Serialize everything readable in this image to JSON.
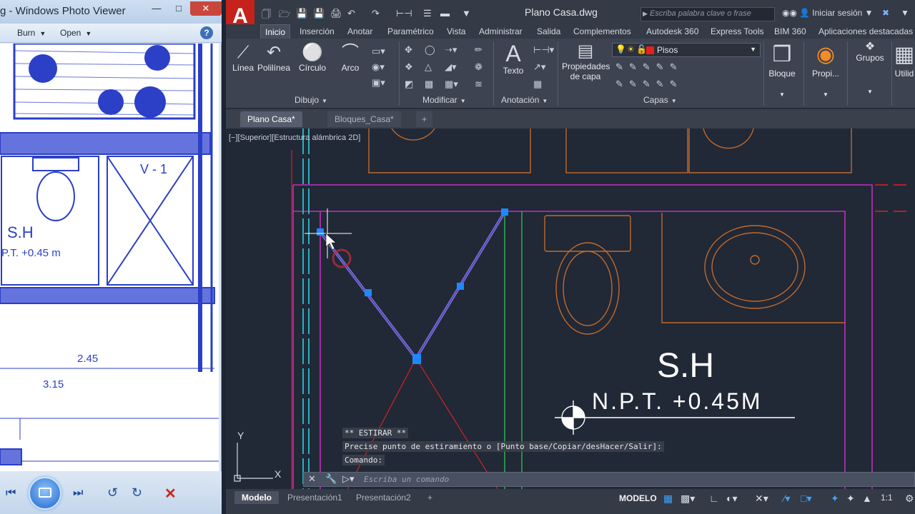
{
  "photo_viewer": {
    "title": "g - Windows Photo Viewer",
    "menu": {
      "burn": "Burn",
      "open": "Open"
    },
    "help_icon": "help-icon",
    "drawing_text": {
      "room": "S.H",
      "level": "P.T. +0.45 m",
      "door": "V - 1",
      "dim1": "2.45",
      "dim2": "3.15"
    },
    "controls": [
      "previous-icon",
      "slideshow-icon",
      "next-icon",
      "rotate-ccw-icon",
      "rotate-cw-icon",
      "delete-icon"
    ]
  },
  "autocad": {
    "logo": "A",
    "document_title": "Plano Casa.dwg",
    "search_placeholder": "Escriba palabra clave o frase",
    "sign_in": "Iniciar sesión",
    "ribbon_tabs": [
      "Inicio",
      "Inserción",
      "Anotar",
      "Paramétrico",
      "Vista",
      "Administrar",
      "Salida",
      "Complementos",
      "Autodesk 360",
      "Express Tools",
      "BIM 360",
      "Aplicaciones destacadas"
    ],
    "active_ribbon_tab": "Inicio",
    "draw_tools": [
      "Línea",
      "Polilínea",
      "Círculo",
      "Arco"
    ],
    "annotation_tool": "Texto",
    "layer_properties": "Propiedades de capa",
    "layer_properties_line1": "Propiedades",
    "layer_properties_line2": "de capa",
    "current_layer": "Pisos",
    "layer_color": "#e8201a",
    "block_tool": "Bloque",
    "properties_tool": "Propi...",
    "groups_tool": "Grupos",
    "utilities_tool": "Utilid",
    "panels": [
      "Dibujo",
      "Modificar",
      "Anotación",
      "Capas"
    ],
    "doc_tabs": [
      "Plano Casa*",
      "Bloques_Casa*"
    ],
    "active_doc_tab": "Plano Casa*",
    "viewport_label": "[−][Superior][Estructura alámbrica 2D]",
    "drawing": {
      "room": "S.H",
      "level": "N.P.T.  +0.45M",
      "axis_x": "X",
      "axis_y": "Y"
    },
    "command_history": [
      "** ESTIRAR **",
      "Precise punto de estiramiento o [Punto base/Copiar/desHacer/Salir]:",
      "Comando:"
    ],
    "command_placeholder": "Escriba un comando",
    "layout_tabs": [
      "Modelo",
      "Presentación1",
      "Presentación2"
    ],
    "active_layout_tab": "Modelo",
    "status_mode": "MODELO",
    "annotation_scale": "1:1"
  }
}
